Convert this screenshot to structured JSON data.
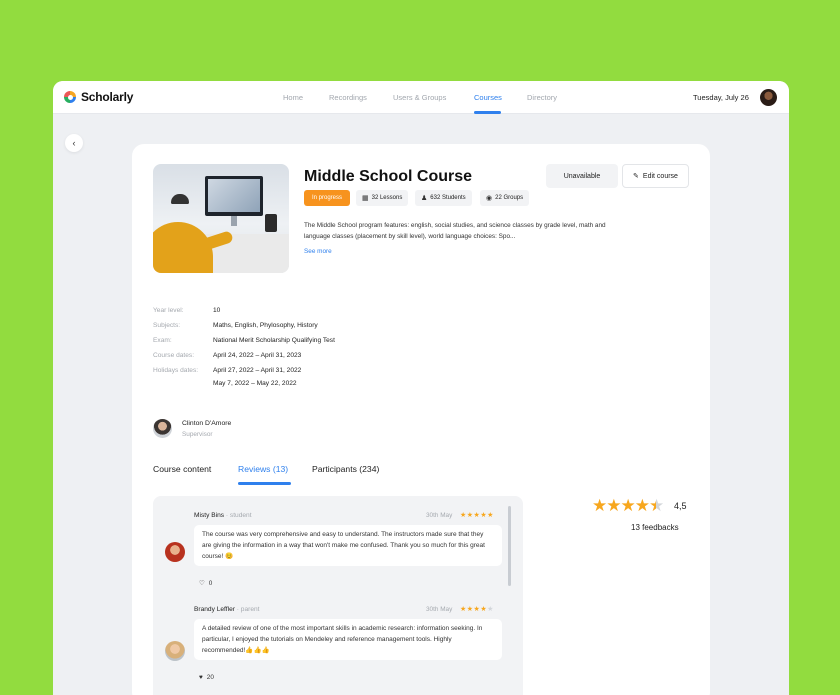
{
  "app": {
    "name": "Scholarly"
  },
  "nav": {
    "items": [
      "Home",
      "Recordings",
      "Users & Groups",
      "Courses",
      "Directory"
    ],
    "active": "Courses"
  },
  "header": {
    "date": "Tuesday, July 26"
  },
  "course": {
    "title": "Middle School Course",
    "status": "In progress",
    "lessons": "32 Lessons",
    "students": "632 Students",
    "groups": "22 Groups",
    "description": "The Middle School program features: english, social studies, and science classes by grade level, math and language classes (placement by skill level), world language choices: Spo...",
    "see_more": "See more",
    "unavailable_label": "Unavailable",
    "edit_label": "Edit course"
  },
  "details": {
    "year_level_label": "Year level:",
    "year_level": "10",
    "subjects_label": "Subjects:",
    "subjects": "Maths, English, Phylosophy, History",
    "exam_label": "Exam:",
    "exam": "National Merit Scholarship Qualifying Test",
    "course_dates_label": "Course dates:",
    "course_dates": "April 24, 2022 – April 31, 2023",
    "holiday_dates_label": "Holidays dates:",
    "holiday_dates_1": "April 27, 2022 – April 31, 2022",
    "holiday_dates_2": "May 7, 2022 – May 22, 2022"
  },
  "supervisor": {
    "name": "Clinton D'Amore",
    "role": "Supervisor"
  },
  "tabs": {
    "content": "Course content",
    "reviews": "Reviews (13)",
    "participants": "Participants (234)",
    "active": "Reviews (13)"
  },
  "reviews": [
    {
      "name": "Misty Bins",
      "role": " · student",
      "date": "30th May",
      "stars": 5,
      "text": "The course was very comprehensive and easy to understand. The instructors made sure that they are giving the information in a way that won't make me confused. Thank you so much for this great course! 😊",
      "likes": "0"
    },
    {
      "name": "Brandy Leffler",
      "role": " · parent",
      "date": "30th May",
      "stars": 4,
      "text": "A detailed review of one of the most important skills in academic research: information seeking. In particular, I enjoyed the tutorials on Mendeley and reference management tools. Highly recommended!👍👍👍",
      "likes": "20"
    }
  ],
  "rating": {
    "value": "4,5",
    "stars": 4.5,
    "feedbacks": "13 feedbacks"
  },
  "colors": {
    "background": "#92dc3f",
    "accent": "#2f80ed",
    "status": "#f7931e",
    "star": "#f7a71e"
  }
}
